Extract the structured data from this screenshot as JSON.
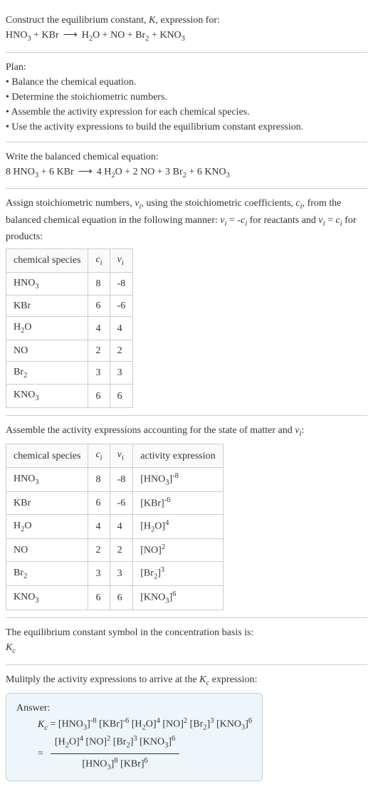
{
  "intro": {
    "line1": "Construct the equilibrium constant, K, expression for:",
    "equation": "HNO₃ + KBr ⟶ H₂O + NO + Br₂ + KNO₃"
  },
  "plan": {
    "title": "Plan:",
    "b1": "• Balance the chemical equation.",
    "b2": "• Determine the stoichiometric numbers.",
    "b3": "• Assemble the activity expression for each chemical species.",
    "b4": "• Use the activity expressions to build the equilibrium constant expression."
  },
  "balanced": {
    "title": "Write the balanced chemical equation:",
    "equation": "8 HNO₃ + 6 KBr ⟶ 4 H₂O + 2 NO + 3 Br₂ + 6 KNO₃"
  },
  "assign": {
    "text": "Assign stoichiometric numbers, νᵢ, using the stoichiometric coefficients, cᵢ, from the balanced chemical equation in the following manner: νᵢ = -cᵢ for reactants and νᵢ = cᵢ for products:",
    "header_species": "chemical species",
    "header_ci": "cᵢ",
    "header_vi": "νᵢ",
    "rows": [
      {
        "sp": "HNO₃",
        "c": "8",
        "v": "-8"
      },
      {
        "sp": "KBr",
        "c": "6",
        "v": "-6"
      },
      {
        "sp": "H₂O",
        "c": "4",
        "v": "4"
      },
      {
        "sp": "NO",
        "c": "2",
        "v": "2"
      },
      {
        "sp": "Br₂",
        "c": "3",
        "v": "3"
      },
      {
        "sp": "KNO₃",
        "c": "6",
        "v": "6"
      }
    ]
  },
  "assemble": {
    "text": "Assemble the activity expressions accounting for the state of matter and νᵢ:",
    "header_species": "chemical species",
    "header_ci": "cᵢ",
    "header_vi": "νᵢ",
    "header_act": "activity expression",
    "rows": [
      {
        "sp": "HNO₃",
        "c": "8",
        "v": "-8",
        "a": "[HNO₃]⁻⁸"
      },
      {
        "sp": "KBr",
        "c": "6",
        "v": "-6",
        "a": "[KBr]⁻⁶"
      },
      {
        "sp": "H₂O",
        "c": "4",
        "v": "4",
        "a": "[H₂O]⁴"
      },
      {
        "sp": "NO",
        "c": "2",
        "v": "2",
        "a": "[NO]²"
      },
      {
        "sp": "Br₂",
        "c": "3",
        "v": "3",
        "a": "[Br₂]³"
      },
      {
        "sp": "KNO₃",
        "c": "6",
        "v": "6",
        "a": "[KNO₃]⁶"
      }
    ]
  },
  "symbol": {
    "line1": "The equilibrium constant symbol in the concentration basis is:",
    "line2": "K_c"
  },
  "multiply": {
    "text": "Mulitply the activity expressions to arrive at the K_c expression:"
  },
  "answer": {
    "label": "Answer:",
    "line1": "K_c = [HNO₃]⁻⁸ [KBr]⁻⁶ [H₂O]⁴ [NO]² [Br₂]³ [KNO₃]⁶",
    "eq": "=",
    "num": "[H₂O]⁴ [NO]² [Br₂]³ [KNO₃]⁶",
    "den": "[HNO₃]⁸ [KBr]⁶"
  }
}
